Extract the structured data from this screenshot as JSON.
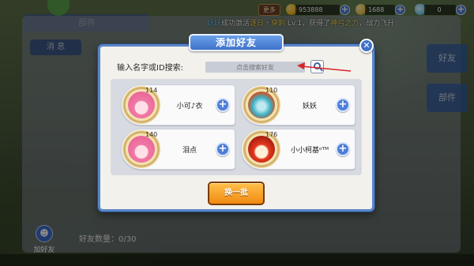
{
  "topbar": {
    "more_label": "更多",
    "gold_value": "953888",
    "coin_value": "1688",
    "gem_value": "0",
    "colors": {
      "gold": "#f5b81c",
      "coin": "#e9c24a",
      "gem": "#7ad0f0"
    }
  },
  "ticker": {
    "player": "妖妖",
    "text1": "成功激活",
    "skill": "逐日・穿刺",
    "text2": " Lv.1，获得了",
    "buff": "神弓之力",
    "text3": "，战力飞升"
  },
  "background": {
    "panel_title": "部件",
    "message_tab": "消 息",
    "side_tabs": [
      "好友",
      "部件"
    ],
    "add_friend_label": "加好友",
    "friend_count_label": "好友数量：",
    "friend_count_value": "0/30"
  },
  "modal": {
    "title": "添加好友",
    "search_label": "输入名字或ID搜索:",
    "search_placeholder": "点击搜索好友",
    "refresh_label": "换一批",
    "accent": "#3f72c9"
  },
  "friends": [
    {
      "level": "114",
      "name": "小可♪衣",
      "avatar": "pink-hair-girl"
    },
    {
      "level": "110",
      "name": "妖妖",
      "avatar": "teal-creature"
    },
    {
      "level": "140",
      "name": "泪点",
      "avatar": "pink-hair-girl"
    },
    {
      "level": "176",
      "name": "小小柯基ᵒᵀᴹ",
      "avatar": "red-haired-boy"
    }
  ]
}
